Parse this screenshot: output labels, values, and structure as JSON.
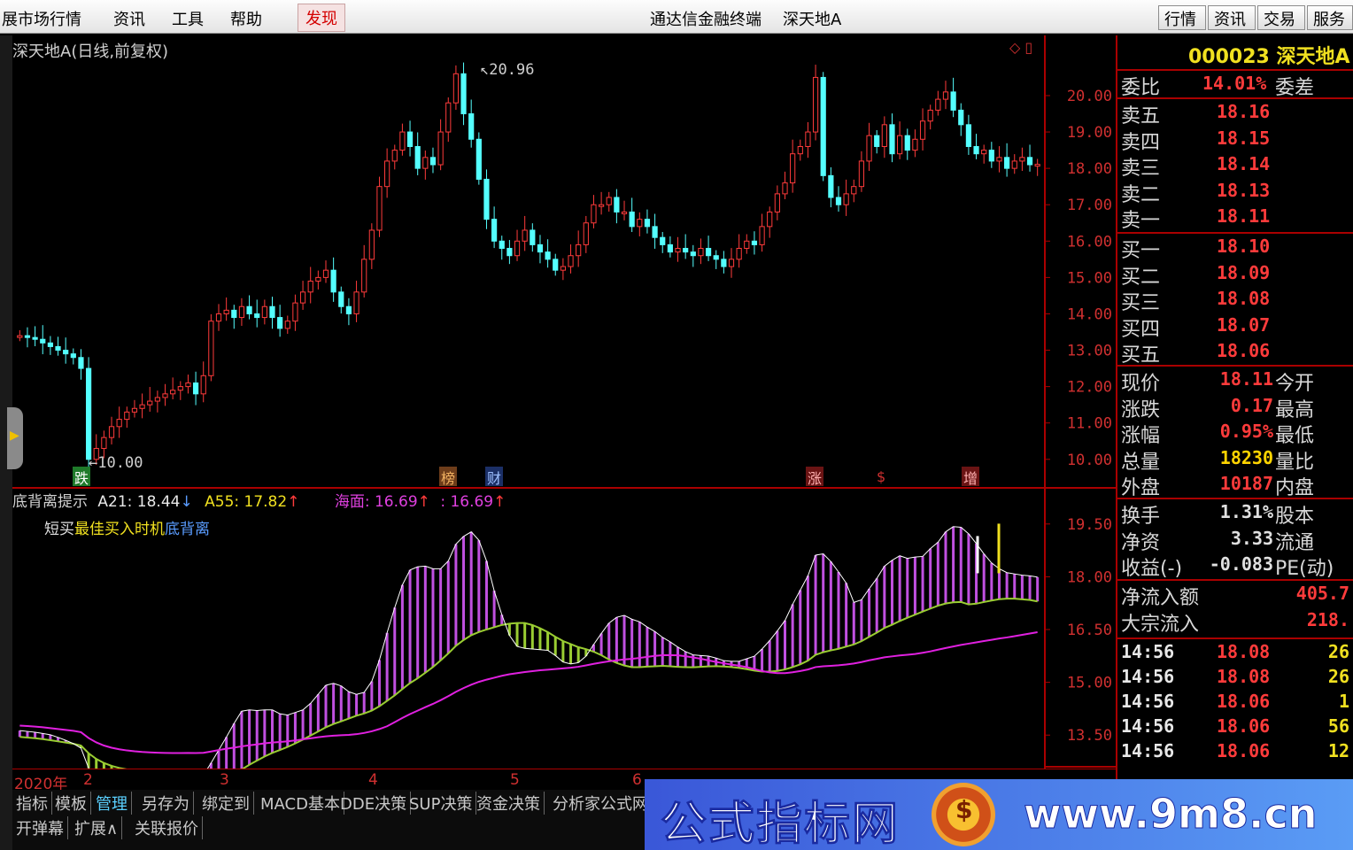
{
  "menubar": {
    "items": [
      "展市场行情",
      "资讯",
      "工具",
      "帮助"
    ],
    "active": "发现",
    "center_title": "通达信金融终端",
    "center_stock": "深天地A",
    "right_tabs": [
      "行情",
      "资讯",
      "交易",
      "服务"
    ]
  },
  "chart": {
    "title": "深天地A(日线,前复权)",
    "high_label": "20.96",
    "low_label": "10.00",
    "price_axis": [
      "20.00",
      "19.00",
      "18.00",
      "17.00",
      "16.00",
      "15.00",
      "14.00",
      "13.00",
      "12.00",
      "11.00",
      "10.00"
    ],
    "markers": [
      {
        "text": "跌",
        "color": "#2fa33a"
      },
      {
        "text": "榜",
        "color": "#d08030"
      },
      {
        "text": "财",
        "color": "#3b78d8"
      },
      {
        "text": "涨",
        "color": "#d03030"
      },
      {
        "text": "$",
        "color": "#d03030"
      },
      {
        "text": "增",
        "color": "#d03030"
      }
    ]
  },
  "indicator": {
    "name": "底背离提示",
    "a21": "A21: 18.44",
    "a55": "A55: 17.82",
    "haimian": "海面: 16.69",
    "v4": ": 16.69",
    "line2_a": "短买",
    "line2_b": "最佳买入时机",
    "line2_c": "底背离",
    "axis": [
      "19.50",
      "18.00",
      "16.50",
      "15.00",
      "13.50"
    ]
  },
  "date_axis": {
    "year": "2020年",
    "months": [
      "2",
      "3",
      "4",
      "5",
      "6"
    ]
  },
  "bottom_tabs": [
    "指标",
    "模板",
    "管理",
    "另存为",
    "绑定到",
    "MACD基本",
    "DDE决策",
    "SUP决策",
    "资金决策",
    "分析家公式网"
  ],
  "bottom_tabs2": [
    "开弹幕",
    "扩展∧",
    "关联报价"
  ],
  "quote": {
    "code_name": "000023 深天地A",
    "weibi_label": "委比",
    "weibi_value": "14.01%",
    "weicha_label": "委差",
    "asks": [
      {
        "label": "卖五",
        "price": "18.16"
      },
      {
        "label": "卖四",
        "price": "18.15"
      },
      {
        "label": "卖三",
        "price": "18.14"
      },
      {
        "label": "卖二",
        "price": "18.13"
      },
      {
        "label": "卖一",
        "price": "18.11"
      }
    ],
    "bids": [
      {
        "label": "买一",
        "price": "18.10"
      },
      {
        "label": "买二",
        "price": "18.09"
      },
      {
        "label": "买三",
        "price": "18.08"
      },
      {
        "label": "买四",
        "price": "18.07"
      },
      {
        "label": "买五",
        "price": "18.06"
      }
    ],
    "stats": [
      {
        "l": "现价",
        "v": "18.11",
        "r": "今开",
        "c": "#ff3b3b"
      },
      {
        "l": "涨跌",
        "v": "0.17",
        "r": "最高",
        "c": "#ff3b3b"
      },
      {
        "l": "涨幅",
        "v": "0.95%",
        "r": "最低",
        "c": "#ff3b3b"
      },
      {
        "l": "总量",
        "v": "18230",
        "r": "量比",
        "c": "#ffd400"
      },
      {
        "l": "外盘",
        "v": "10187",
        "r": "内盘",
        "c": "#ff3b3b"
      }
    ],
    "stats2": [
      {
        "l": "换手",
        "v": "1.31%",
        "r": "股本",
        "c": "#e0e0e0"
      },
      {
        "l": "净资",
        "v": "3.33",
        "r": "流通",
        "c": "#e0e0e0"
      },
      {
        "l": "收益(-)",
        "v": "-0.083",
        "r": "PE(动)",
        "c": "#e0e0e0"
      }
    ],
    "flow": [
      {
        "l": "净流入额",
        "v": "405.7"
      },
      {
        "l": "大宗流入",
        "v": "218."
      }
    ],
    "ticks": [
      {
        "t": "14:56",
        "p": "18.08",
        "v": "26"
      },
      {
        "t": "14:56",
        "p": "18.08",
        "v": "26"
      },
      {
        "t": "14:56",
        "p": "18.06",
        "v": "1"
      },
      {
        "t": "14:56",
        "p": "18.06",
        "v": "56"
      },
      {
        "t": "14:56",
        "p": "18.06",
        "v": "12"
      }
    ]
  },
  "watermark": {
    "text": "公式指标网",
    "url": "www.9m8.cn"
  },
  "chart_data": {
    "type": "candlestick",
    "title": "深天地A(日线,前复权)",
    "ylim": [
      10,
      21
    ],
    "high": 20.96,
    "low": 10.0,
    "closes": [
      13.4,
      13.35,
      13.3,
      13.2,
      13.1,
      13.0,
      12.9,
      12.8,
      12.5,
      10.0,
      10.3,
      10.6,
      10.9,
      11.1,
      11.3,
      11.4,
      11.5,
      11.6,
      11.7,
      11.8,
      11.9,
      12.0,
      12.1,
      11.8,
      12.3,
      13.8,
      14.0,
      14.1,
      13.9,
      14.2,
      14.0,
      13.9,
      14.2,
      13.9,
      13.6,
      13.8,
      14.3,
      14.6,
      14.9,
      15.0,
      15.2,
      14.6,
      14.2,
      14.0,
      14.6,
      15.5,
      16.3,
      17.5,
      18.2,
      18.5,
      19.0,
      18.6,
      18.0,
      18.3,
      18.1,
      19.0,
      19.8,
      20.6,
      19.5,
      18.8,
      17.7,
      16.6,
      16.0,
      15.8,
      15.6,
      16.0,
      16.3,
      15.9,
      15.7,
      15.5,
      15.2,
      15.3,
      15.6,
      15.9,
      16.5,
      17.0,
      17.0,
      17.2,
      16.8,
      16.8,
      16.4,
      16.6,
      16.4,
      16.1,
      15.9,
      15.7,
      15.8,
      15.7,
      15.6,
      15.8,
      15.6,
      15.5,
      15.3,
      15.5,
      15.8,
      16.0,
      15.9,
      16.4,
      16.8,
      17.3,
      17.6,
      18.4,
      18.6,
      19.0,
      20.5,
      17.8,
      17.2,
      17.0,
      17.3,
      17.5,
      18.2,
      18.9,
      18.6,
      19.2,
      18.4,
      18.9,
      18.5,
      18.8,
      19.3,
      19.6,
      19.9,
      20.1,
      19.6,
      19.2,
      18.6,
      18.4,
      18.5,
      18.2,
      18.3,
      18.0,
      18.2,
      18.3,
      18.1,
      18.11
    ]
  }
}
